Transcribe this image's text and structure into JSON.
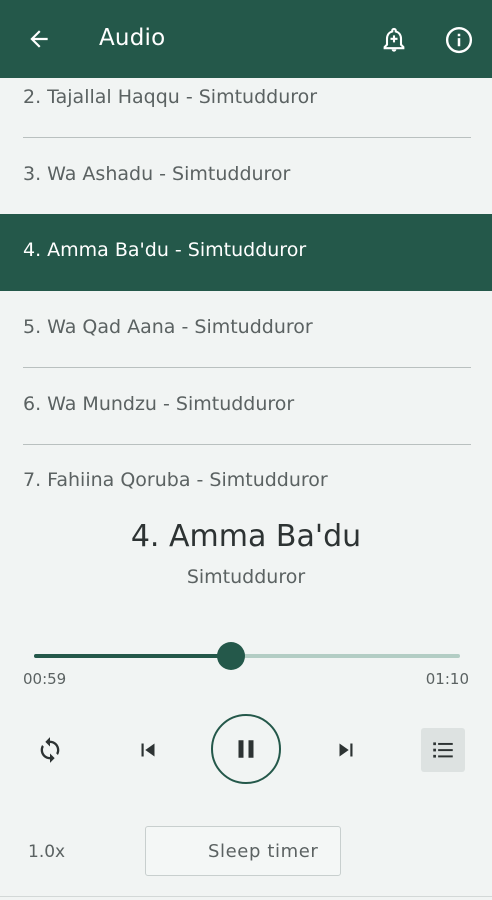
{
  "appbar": {
    "title": "Audio",
    "back_icon": "arrow-left-icon",
    "bell_icon": "bell-plus-icon",
    "info_icon": "info-circle-icon"
  },
  "playlist": {
    "tracks": [
      {
        "label": "2. Tajallal Haqqu - Simtudduror",
        "active": false
      },
      {
        "label": "3. Wa Ashadu - Simtudduror",
        "active": false
      },
      {
        "label": "4. Amma Ba'du - Simtudduror",
        "active": true
      },
      {
        "label": "5. Wa Qad Aana - Simtudduror",
        "active": false
      },
      {
        "label": "6. Wa Mundzu - Simtudduror",
        "active": false
      },
      {
        "label": "7. Fahiina Qoruba - Simtudduror",
        "active": false
      }
    ]
  },
  "now_playing": {
    "title": "4. Amma Ba'du",
    "artist": "Simtudduror"
  },
  "progress": {
    "elapsed": "00:59",
    "total": "01:10",
    "fraction": 0.462
  },
  "controls": {
    "repeat_icon": "repeat-icon",
    "prev_icon": "skip-previous-icon",
    "play_icon": "pause-icon",
    "next_icon": "skip-next-icon",
    "list_icon": "playlist-icon"
  },
  "footer": {
    "speed": "1.0x",
    "sleep_label": "Sleep timer",
    "sleep_icon": "moon-icon"
  },
  "colors": {
    "primary": "#24584a",
    "track_inactive": "#b3cdc4",
    "background": "#f1f4f3"
  }
}
